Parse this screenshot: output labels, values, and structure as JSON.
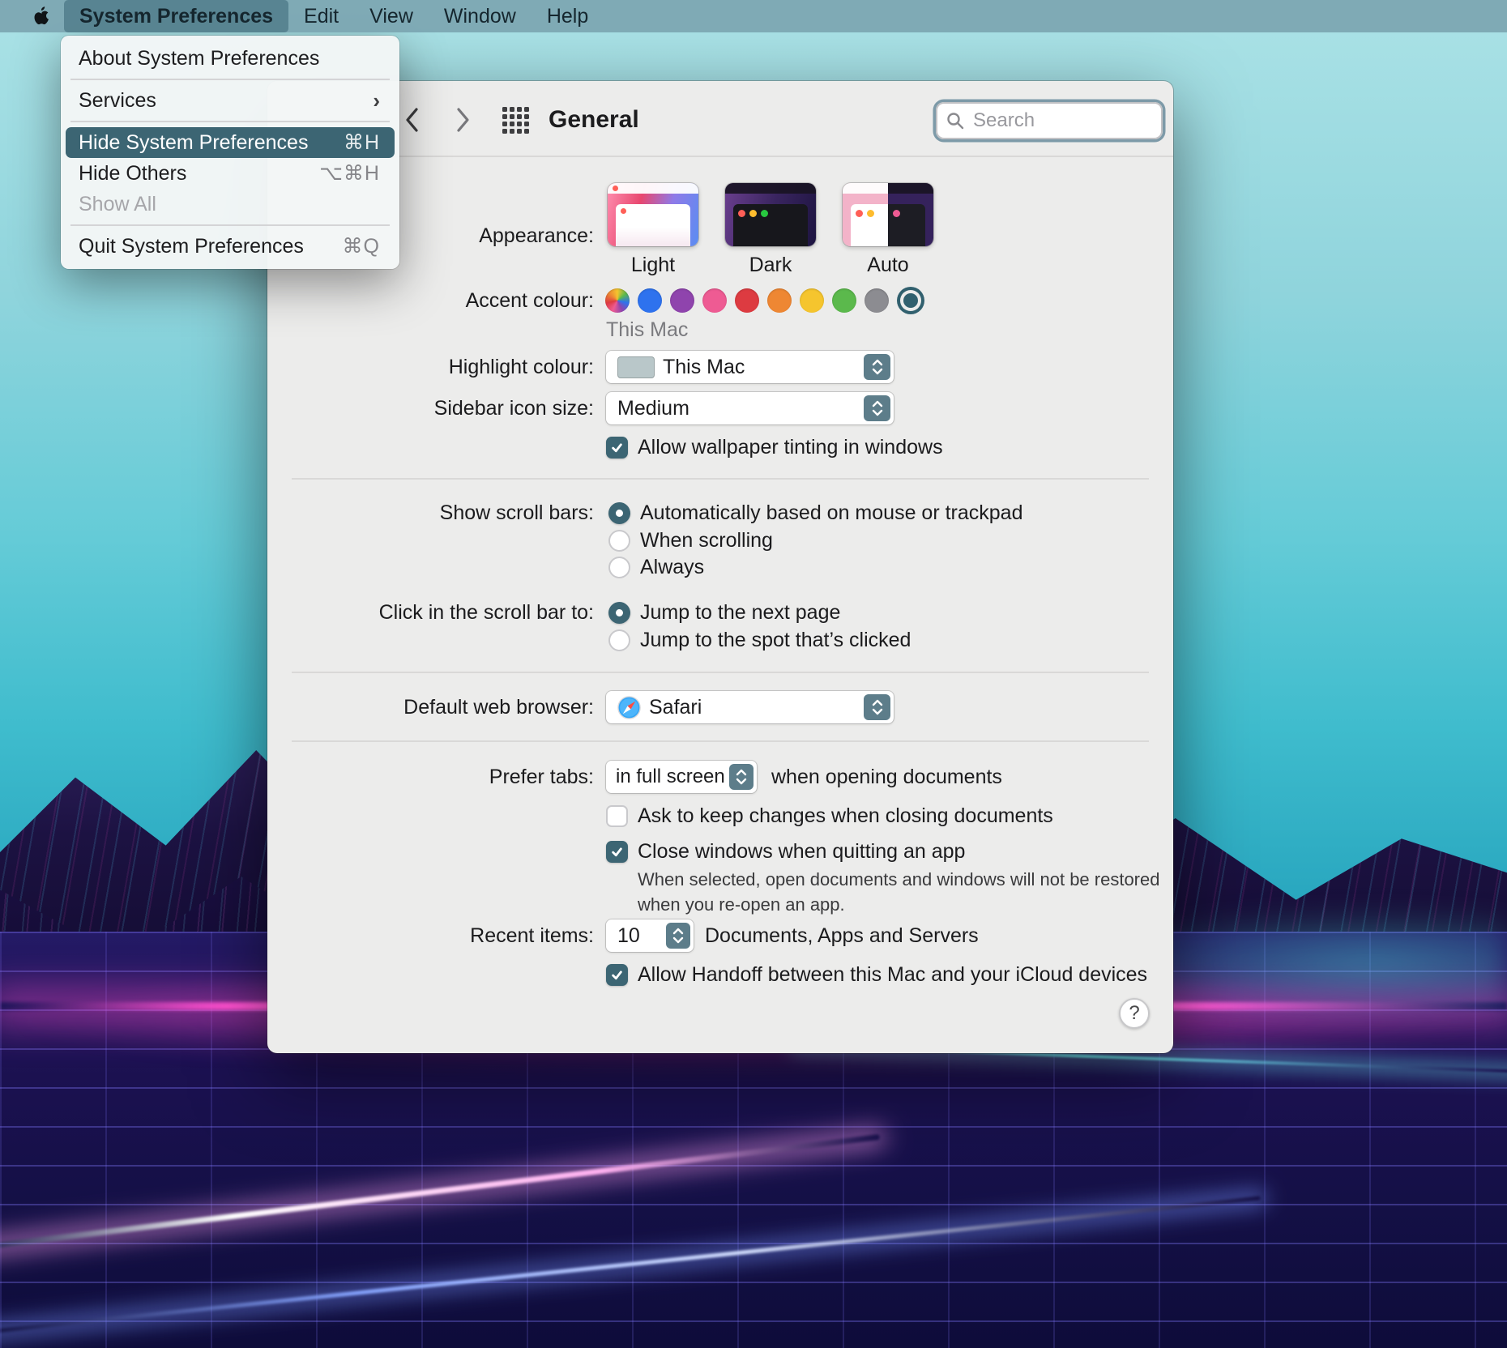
{
  "menu_bar": {
    "menus": [
      {
        "label": "System Preferences"
      },
      {
        "label": "Edit"
      },
      {
        "label": "View"
      },
      {
        "label": "Window"
      },
      {
        "label": "Help"
      }
    ]
  },
  "app_menu": {
    "about": "About System Preferences",
    "services": "Services",
    "hide": "Hide System Preferences",
    "hide_shortcut": "⌘H",
    "hide_others": "Hide Others",
    "hide_others_shortcut": "⌥⌘H",
    "show_all": "Show All",
    "quit": "Quit System Preferences",
    "quit_shortcut": "⌘Q"
  },
  "window": {
    "title": "General",
    "search_placeholder": "Search",
    "help": "?"
  },
  "general": {
    "appearance": {
      "label": "Appearance:",
      "options": [
        "Light",
        "Dark",
        "Auto"
      ]
    },
    "accent": {
      "label": "Accent colour:",
      "note": "This Mac",
      "colors": [
        {
          "name": "multicolour"
        },
        {
          "name": "blue",
          "hex": "#2e72ee"
        },
        {
          "name": "purple",
          "hex": "#8f44ad"
        },
        {
          "name": "pink",
          "hex": "#ee5b93"
        },
        {
          "name": "red",
          "hex": "#dd3b41"
        },
        {
          "name": "orange",
          "hex": "#ee8733"
        },
        {
          "name": "yellow",
          "hex": "#f5c52e"
        },
        {
          "name": "green",
          "hex": "#5bb94c"
        },
        {
          "name": "graphite",
          "hex": "#8c8c91"
        },
        {
          "name": "teal-selected",
          "hex": "#31606e",
          "selected": true
        }
      ]
    },
    "highlight": {
      "label": "Highlight colour:",
      "value": "This Mac",
      "swatch": "#b9c7c9"
    },
    "sidebar_size": {
      "label": "Sidebar icon size:",
      "value": "Medium"
    },
    "wallpaper_tint": {
      "label": "Allow wallpaper tinting in windows",
      "checked": true
    },
    "scroll_bars": {
      "label": "Show scroll bars:",
      "options": [
        {
          "label": "Automatically based on mouse or trackpad",
          "selected": true
        },
        {
          "label": "When scrolling",
          "selected": false
        },
        {
          "label": "Always",
          "selected": false
        }
      ]
    },
    "scroll_click": {
      "label": "Click in the scroll bar to:",
      "options": [
        {
          "label": "Jump to the next page",
          "selected": true
        },
        {
          "label": "Jump to the spot that’s clicked",
          "selected": false
        }
      ]
    },
    "browser": {
      "label": "Default web browser:",
      "value": "Safari"
    },
    "prefer_tabs": {
      "label": "Prefer tabs:",
      "value": "in full screen",
      "suffix": "when opening documents"
    },
    "ask_keep": {
      "label": "Ask to keep changes when closing documents",
      "checked": false
    },
    "close_windows": {
      "label": "Close windows when quitting an app",
      "checked": true,
      "note": "When selected, open documents and windows will not be restored when you re-open an app."
    },
    "recent_items": {
      "label": "Recent items:",
      "value": "10",
      "suffix": "Documents, Apps and Servers"
    },
    "handoff": {
      "label": "Allow Handoff between this Mac and your iCloud devices",
      "checked": true
    }
  },
  "colors": {
    "accent": "#3c6573",
    "menu_highlight": "#3c6573",
    "stepper": "#5d7d8a",
    "search_ring": "#7d9aa8"
  }
}
